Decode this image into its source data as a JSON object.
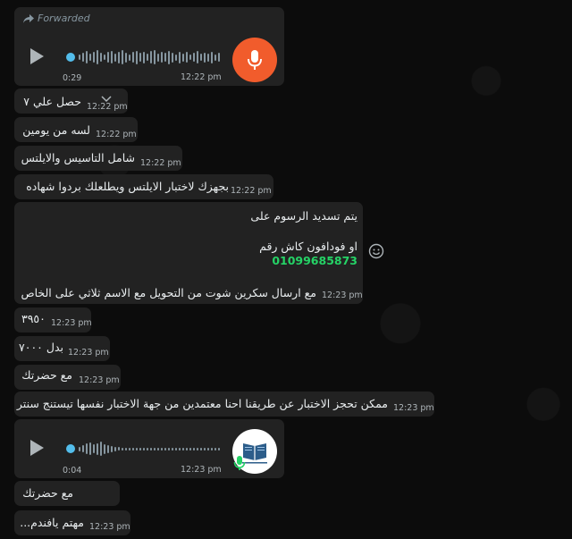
{
  "colors": {
    "bubble": "#222222",
    "accent_blue": "#53bdeb",
    "mic_orange": "#f15c2c",
    "phone_green": "#25d366",
    "time_gray": "#aeb5b9"
  },
  "messages": {
    "voice1": {
      "forwarded_label": "Forwarded",
      "duration": "0:29",
      "time": "12:22 pm"
    },
    "m1": {
      "text": "حصل علي ٧",
      "time": "12:22 pm"
    },
    "m2": {
      "text": "لسه من يومين",
      "time": "12:22 pm"
    },
    "m3": {
      "text": "شامل التاسيس والايلتس",
      "time": "12:22 pm"
    },
    "m4": {
      "text": "بجهزك لاختبار الايلتس ويطلعلك بردوا شهاده",
      "time": "12:22 pm"
    },
    "m5": {
      "line1": "يتم تسديد الرسوم على",
      "line2": "او فودافون كاش رقم",
      "phone": "01099685873",
      "line3": "مع ارسال سكرين شوت من التحويل مع الاسم ثلاثي على الخاص",
      "time": "12:23 pm"
    },
    "m6": {
      "text": "٣٩٥٠",
      "time": "12:23 pm"
    },
    "m7": {
      "text": "بدل ٧٠٠٠",
      "time": "12:23 pm"
    },
    "m8": {
      "text": "مع حضرتك",
      "time": "12:23 pm"
    },
    "m9": {
      "text": "ممكن تحجز الاختبار عن طريقنا احنا معتمدين من جهة الاختبار نفسها تيستنج سنتر",
      "time": "12:23 pm"
    },
    "voice2": {
      "duration": "0:04",
      "time": "12:23 pm"
    },
    "m10": {
      "text": "مع حضرتك",
      "time": ""
    },
    "m11": {
      "text": "مهتم يافندم...",
      "time": "12:23 pm"
    }
  },
  "icons": {
    "forward": "forward-arrow-icon",
    "mic": "microphone-icon",
    "play": "play-icon",
    "chevron": "chevron-down-icon",
    "emoji": "emoji-icon"
  }
}
